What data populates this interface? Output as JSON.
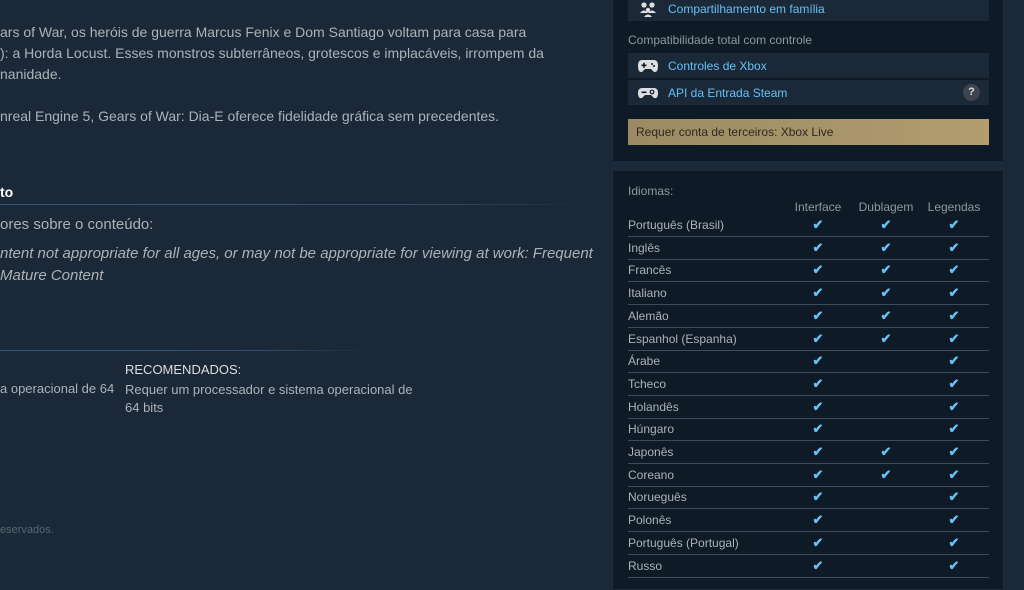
{
  "description": {
    "p1_lines": [
      "ars of War, os heróis de guerra Marcus Fenix e Dom Santiago voltam para casa para",
      "): a Horda Locust. Esses monstros subterrâneos, grotescos e implacáveis, irrompem da",
      "nanidade."
    ],
    "p2": "nreal Engine 5, Gears of War: Dia-E oferece fidelidade gráfica sem precedentes."
  },
  "mature": {
    "section_title": "to",
    "label": "ores sobre o conteúdo:",
    "lines": [
      "ntent not appropriate for all ages, or may not be appropriate for viewing at work: Frequent",
      "Mature Content"
    ]
  },
  "requirements": {
    "min_text": "a operacional de 64",
    "recommended_header": "RECOMENDADOS:",
    "recommended_text": "Requer um processador e sistema operacional de 64 bits"
  },
  "footer": "eservados.",
  "features": {
    "family_sharing": "Compartilhamento em família",
    "controller_header": "Compatibilidade total com controle",
    "xbox_controllers": "Controles de Xbox",
    "steam_input": "API da Entrada Steam",
    "help": "?",
    "third_party": "Requer conta de terceiros: Xbox Live"
  },
  "languages": {
    "title": "Idiomas:",
    "columns": [
      "Interface",
      "Dublagem",
      "Legendas"
    ],
    "check_glyph": "✔",
    "rows": [
      {
        "name": "Português (Brasil)",
        "interface": true,
        "audio": true,
        "subtitles": true
      },
      {
        "name": "Inglês",
        "interface": true,
        "audio": true,
        "subtitles": true
      },
      {
        "name": "Francês",
        "interface": true,
        "audio": true,
        "subtitles": true
      },
      {
        "name": "Italiano",
        "interface": true,
        "audio": true,
        "subtitles": true
      },
      {
        "name": "Alemão",
        "interface": true,
        "audio": true,
        "subtitles": true
      },
      {
        "name": "Espanhol (Espanha)",
        "interface": true,
        "audio": true,
        "subtitles": true
      },
      {
        "name": "Árabe",
        "interface": true,
        "audio": false,
        "subtitles": true
      },
      {
        "name": "Tcheco",
        "interface": true,
        "audio": false,
        "subtitles": true
      },
      {
        "name": "Holandês",
        "interface": true,
        "audio": false,
        "subtitles": true
      },
      {
        "name": "Húngaro",
        "interface": true,
        "audio": false,
        "subtitles": true
      },
      {
        "name": "Japonês",
        "interface": true,
        "audio": true,
        "subtitles": true
      },
      {
        "name": "Coreano",
        "interface": true,
        "audio": true,
        "subtitles": true
      },
      {
        "name": "Norueguês",
        "interface": true,
        "audio": false,
        "subtitles": true
      },
      {
        "name": "Polonês",
        "interface": true,
        "audio": false,
        "subtitles": true
      },
      {
        "name": "Português (Portugal)",
        "interface": true,
        "audio": false,
        "subtitles": true
      },
      {
        "name": "Russo",
        "interface": true,
        "audio": false,
        "subtitles": true
      }
    ]
  }
}
